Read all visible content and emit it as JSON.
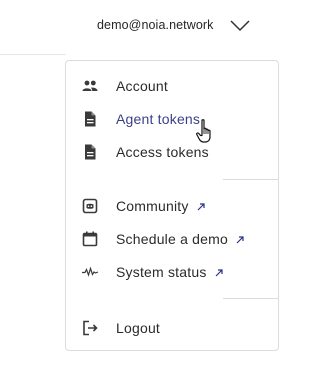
{
  "header": {
    "user_email": "demo@noia.network",
    "dropdown_icon": "chevron-down-icon"
  },
  "menu": {
    "items": [
      {
        "label": "Account",
        "icon": "users-icon",
        "active": false,
        "external": false
      },
      {
        "label": "Agent tokens",
        "icon": "document-icon",
        "active": true,
        "external": false
      },
      {
        "label": "Access tokens",
        "icon": "document-icon",
        "active": false,
        "external": false
      },
      {
        "label": "Community",
        "icon": "discord-icon",
        "active": false,
        "external": true
      },
      {
        "label": "Schedule a demo",
        "icon": "calendar-icon",
        "active": false,
        "external": true
      },
      {
        "label": "System status",
        "icon": "pulse-icon",
        "active": false,
        "external": true
      },
      {
        "label": "Logout",
        "icon": "logout-icon",
        "active": false,
        "external": false
      }
    ]
  },
  "colors": {
    "text": "#2b2b2b",
    "active_text": "#3b3f88",
    "border": "#dcdcdc",
    "external_arrow": "#2a2f86"
  }
}
